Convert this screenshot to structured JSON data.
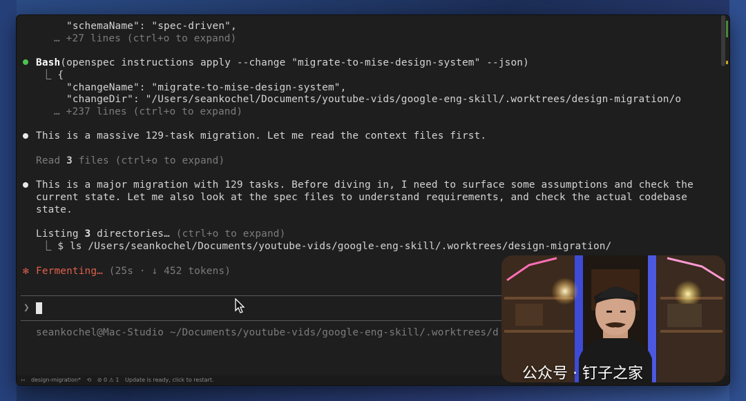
{
  "terminal": {
    "schema_line": "\"schemaName\": \"spec-driven\",",
    "schema_more": "… +27 lines (ctrl+o to expand)",
    "bash_tool": "Bash",
    "bash_cmd": "(openspec instructions apply --change \"migrate-to-mise-design-system\" --json)",
    "bash_open": "⎿ {",
    "change_name": "\"changeName\": \"migrate-to-mise-design-system\",",
    "change_dir": "\"changeDir\": \"/Users/seankochel/Documents/youtube-vids/google-eng-skill/.worktrees/design-migration/o",
    "bash_more": "… +237 lines (ctrl+o to expand)",
    "msg1": "This is a massive 129-task migration. Let me read the context files first.",
    "read_prefix": "Read ",
    "read_count": "3",
    "read_suffix": " files (ctrl+o to expand)",
    "msg2_l1": "This is a major migration with 129 tasks. Before diving in, I need to surface some assumptions and check the",
    "msg2_l2": "current state. Let me also look at the spec files to understand requirements, and check the actual codebase",
    "msg2_l3": "state.",
    "listing_prefix": "Listing ",
    "listing_count": "3",
    "listing_word": " directories…",
    "listing_hint": " (ctrl+o to expand)",
    "ls_cmd": "⎿ $ ls /Users/seankochel/Documents/youtube-vids/google-eng-skill/.worktrees/design-migration/",
    "spinner": "✻",
    "ferment_word": "Fermenting…",
    "ferment_stats": " (25s · ↓ 452 tokens)",
    "prompt_glyph": "❯",
    "footer_path": "seankochel@Mac-Studio ~/Documents/youtube-vids/google-eng-skill/.worktrees/d"
  },
  "statusbar": {
    "branch": "design-migration*",
    "sync": "⟲",
    "problems": "⊘ 0 ⚠ 1",
    "update": "Update is ready, click to restart."
  },
  "watermark": "公众号 · 钉子之家",
  "colors": {
    "accent_green": "#4ec24e",
    "ferment_red": "#e0614c",
    "terminal_bg": "#1e1e1e"
  }
}
